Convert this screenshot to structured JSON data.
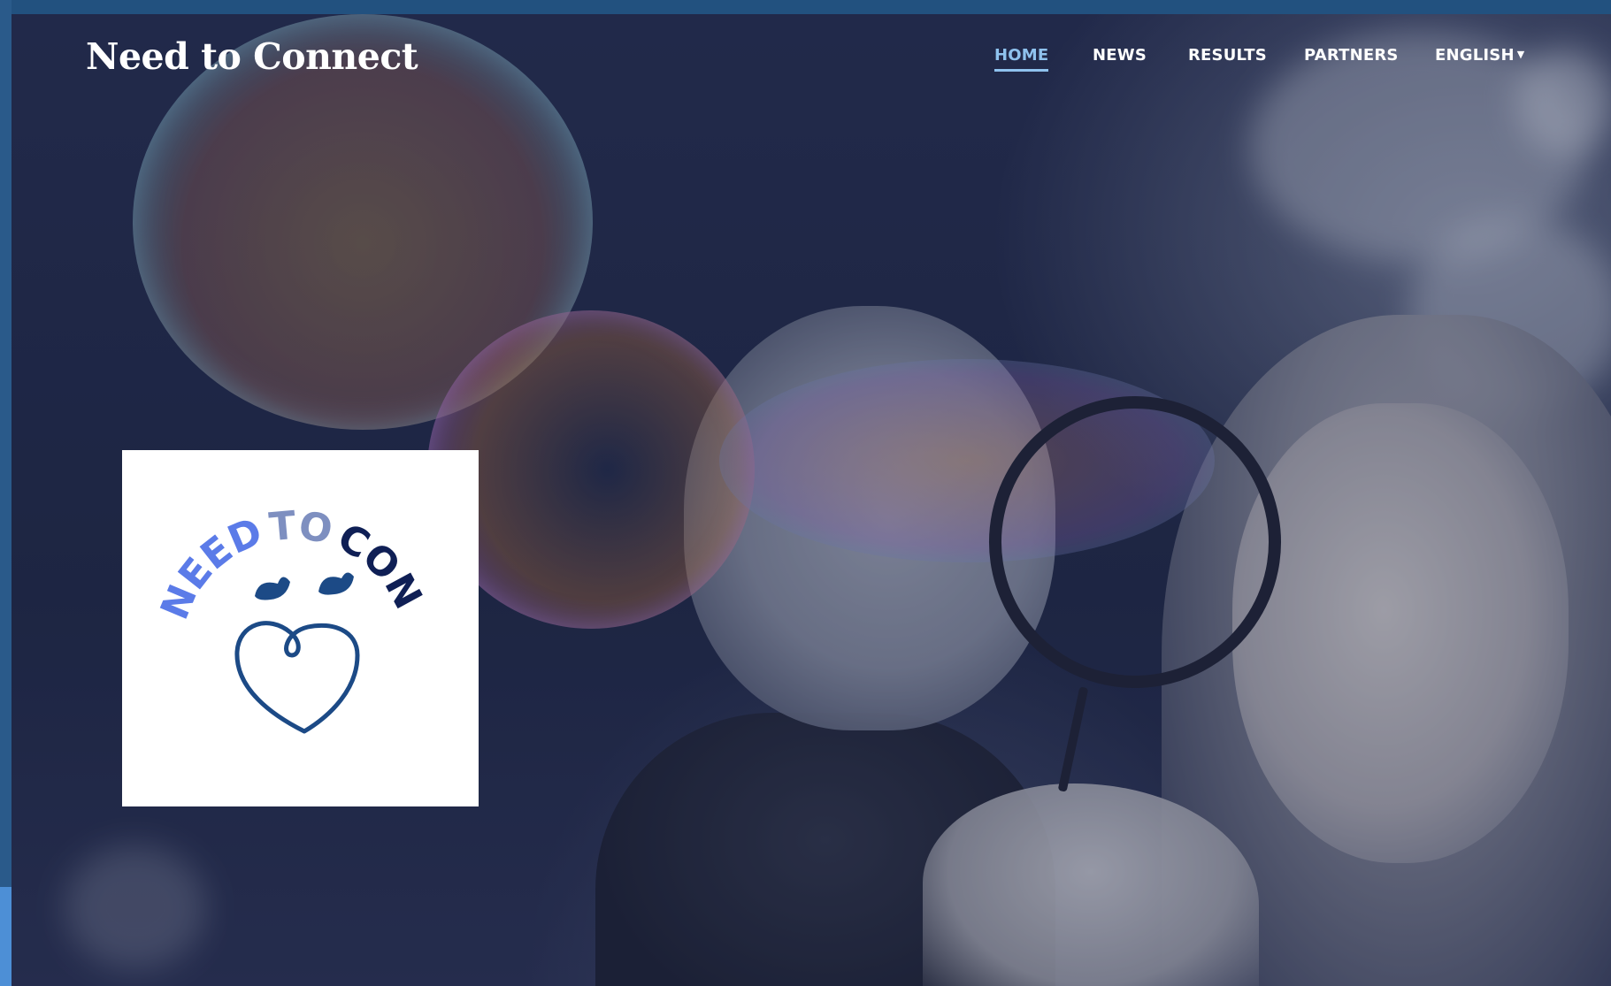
{
  "site": {
    "title": "Need to Connect"
  },
  "nav": {
    "items": [
      {
        "label": "HOME",
        "active": true
      },
      {
        "label": "NEWS",
        "active": false
      },
      {
        "label": "RESULTS",
        "active": false
      },
      {
        "label": "PARTNERS",
        "active": false
      },
      {
        "label": "ENGLISH",
        "active": false,
        "dropdown": true
      }
    ]
  },
  "logo": {
    "text_need": "NEED",
    "text_to": "TO",
    "text_connect": "CONNECT"
  },
  "colors": {
    "frame": "#22517f",
    "nav_active": "#8fc2ee",
    "logo_blue_light": "#5b7be8",
    "logo_blue_mid": "#7e8fc0",
    "logo_navy": "#0f1f55",
    "heart": "#1c4a86"
  },
  "icons": {
    "dropdown": "chevron-down-icon"
  }
}
